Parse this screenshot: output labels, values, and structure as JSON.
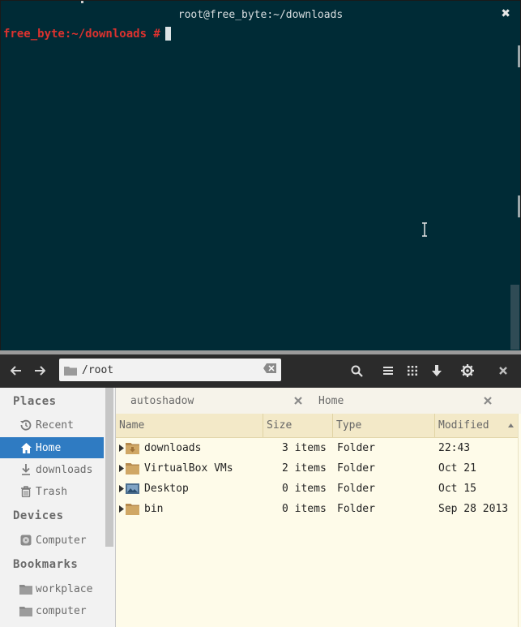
{
  "terminal": {
    "title": "root@free_byte:~/downloads",
    "prompt": "free_byte:~/downloads #",
    "close_glyph": "✖"
  },
  "toolbar": {
    "path": "/root",
    "icons": [
      "back-icon",
      "forward-icon",
      "search-icon",
      "list-view-icon",
      "grid-view-icon",
      "download-icon",
      "gear-icon",
      "close-icon"
    ]
  },
  "sidebar": {
    "places_header": "Places",
    "places": [
      {
        "label": "Recent",
        "icon": "recent-icon"
      },
      {
        "label": "Home",
        "icon": "home-icon",
        "active": true
      },
      {
        "label": "downloads",
        "icon": "downloads-icon"
      },
      {
        "label": "Trash",
        "icon": "trash-icon"
      }
    ],
    "devices_header": "Devices",
    "devices": [
      {
        "label": "Computer",
        "icon": "drive-icon"
      }
    ],
    "bookmarks_header": "Bookmarks",
    "bookmarks": [
      {
        "label": "workplace",
        "icon": "folder-icon"
      },
      {
        "label": "computer",
        "icon": "folder-icon"
      }
    ]
  },
  "tabs": [
    {
      "label": "autoshadow"
    },
    {
      "label": "Home"
    }
  ],
  "columns": {
    "name": "Name",
    "size": "Size",
    "type": "Type",
    "modified": "Modified"
  },
  "files": [
    {
      "name": "downloads",
      "size": "3 items",
      "type": "Folder",
      "modified": "22:43",
      "icon": "downloads-folder-icon"
    },
    {
      "name": "VirtualBox VMs",
      "size": "2 items",
      "type": "Folder",
      "modified": "Oct 21",
      "icon": "folder-icon"
    },
    {
      "name": "Desktop",
      "size": "0 items",
      "type": "Folder",
      "modified": "Oct 15",
      "icon": "desktop-folder-icon"
    },
    {
      "name": "bin",
      "size": "0 items",
      "type": "Folder",
      "modified": "Sep 28 2013",
      "icon": "folder-icon"
    }
  ],
  "colors": {
    "terminal_bg": "#002b36",
    "prompt": "#dc322f",
    "selection": "#2f7bc2",
    "list_bg": "#fefbe9",
    "header_bg": "#f3e9c8"
  }
}
